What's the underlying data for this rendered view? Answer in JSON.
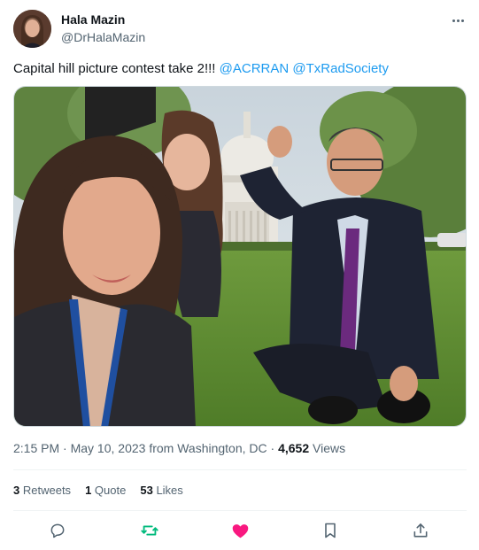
{
  "author": {
    "name": "Hala Mazin",
    "handle": "@DrHalaMazin"
  },
  "tweet": {
    "text": "Capital hill picture contest take 2!!!",
    "mentions": [
      "@ACRRAN",
      "@TxRadSociety"
    ]
  },
  "meta": {
    "time": "2:15 PM",
    "date": "May 10, 2023",
    "location": "from Washington, DC",
    "views_count": "4,652",
    "views_label": "Views"
  },
  "stats": {
    "retweets_count": "3",
    "retweets_label": "Retweets",
    "quotes_count": "1",
    "quotes_label": "Quote",
    "likes_count": "53",
    "likes_label": "Likes"
  },
  "icons": {
    "more": "more-horizontal-icon",
    "reply": "reply-icon",
    "retweet": "retweet-icon",
    "like": "heart-icon",
    "bookmark": "bookmark-icon",
    "share": "share-icon"
  },
  "colors": {
    "link": "#1d9bf0",
    "retweet_active": "#00ba7c",
    "like_active": "#f91880",
    "secondary_text": "#536471"
  }
}
